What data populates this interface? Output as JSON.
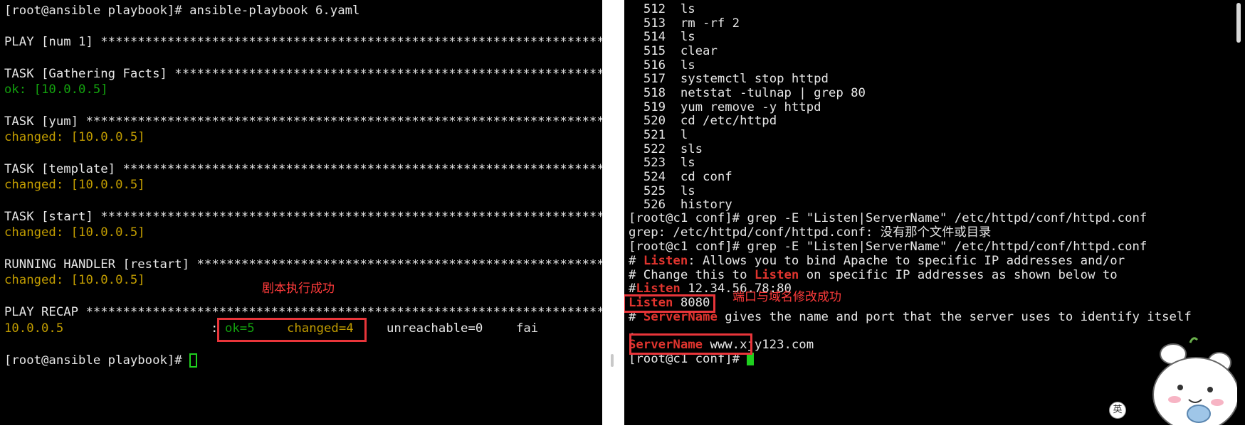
{
  "left_terminal": {
    "prompt_line": "[root@ansible playbook]# ansible-playbook 6.yaml",
    "play_line": "PLAY [num 1] *********************************************************************",
    "task_gather": "TASK [Gathering Facts] ***********************************************************",
    "ok_gather": "ok: [10.0.0.5]",
    "task_yum": "TASK [yum] ***********************************************************************",
    "chg_yum": "changed: [10.0.0.5]",
    "task_template": "TASK [template] ******************************************************************",
    "chg_template": "changed: [10.0.0.5]",
    "task_start": "TASK [start] *********************************************************************",
    "chg_start": "changed: [10.0.0.5]",
    "handler_line": "RUNNING HANDLER [restart] ********************************************************",
    "chg_handler": "changed: [10.0.0.5]",
    "recap_line": "PLAY RECAP ***********************************************************************",
    "recap_host": "10.0.0.5",
    "recap_colon": ":",
    "recap_ok": "ok=5",
    "recap_changed": "changed=4",
    "recap_unreachable": "unreachable=0",
    "recap_failed": "fai",
    "final_prompt": "[root@ansible playbook]# ",
    "annotation": "剧本执行成功"
  },
  "right_terminal": {
    "history": [
      {
        "num": "512",
        "cmd": "ls"
      },
      {
        "num": "513",
        "cmd": "rm -rf 2"
      },
      {
        "num": "514",
        "cmd": "ls"
      },
      {
        "num": "515",
        "cmd": "clear"
      },
      {
        "num": "516",
        "cmd": "ls"
      },
      {
        "num": "517",
        "cmd": "systemctl stop httpd"
      },
      {
        "num": "518",
        "cmd": "netstat -tulnap | grep 80"
      },
      {
        "num": "519",
        "cmd": "yum remove -y httpd"
      },
      {
        "num": "520",
        "cmd": "cd /etc/httpd"
      },
      {
        "num": "521",
        "cmd": "l"
      },
      {
        "num": "522",
        "cmd": "sls"
      },
      {
        "num": "523",
        "cmd": "ls"
      },
      {
        "num": "524",
        "cmd": "cd conf"
      },
      {
        "num": "525",
        "cmd": "ls"
      },
      {
        "num": "526",
        "cmd": "history"
      }
    ],
    "grep_cmd_1": "[root@c1 conf]# grep -E \"Listen|ServerName\" /etc/httpd/conf/httpd.conf",
    "grep_error": "grep: /etc/httpd/conf/httpd.conf: 没有那个文件或目录",
    "grep_cmd_2": "[root@c1 conf]# grep -E \"Listen|ServerName\" /etc/httpd/conf/httpd.conf",
    "out1_pre": "# ",
    "kw_listen": "Listen",
    "out1_post": ": Allows you to bind Apache to specific IP addresses and/or",
    "out2_pre": "# Change this to ",
    "out2_post": " on specific IP addresses as shown below to",
    "out3_pre": "#",
    "out3_post": " 12.34.56.78:80",
    "out4_post": " 8080",
    "out5_pre": "# ",
    "kw_servername": "ServerName",
    "out5_post": " gives the name and port that the server uses to identify itself",
    "out6": ".",
    "out7_post": " www.xjy123.com",
    "final_prompt": "[root@c1 conf]# ",
    "annotation": "端口与域名修改成功"
  },
  "ime_badge": "英",
  "colors": {
    "ok_green": "#13a10e",
    "changed_yellow": "#c19c00",
    "keyword_red": "#e0342e",
    "annotation_red": "#ff3b3b",
    "cursor_green": "#1fd01f"
  }
}
